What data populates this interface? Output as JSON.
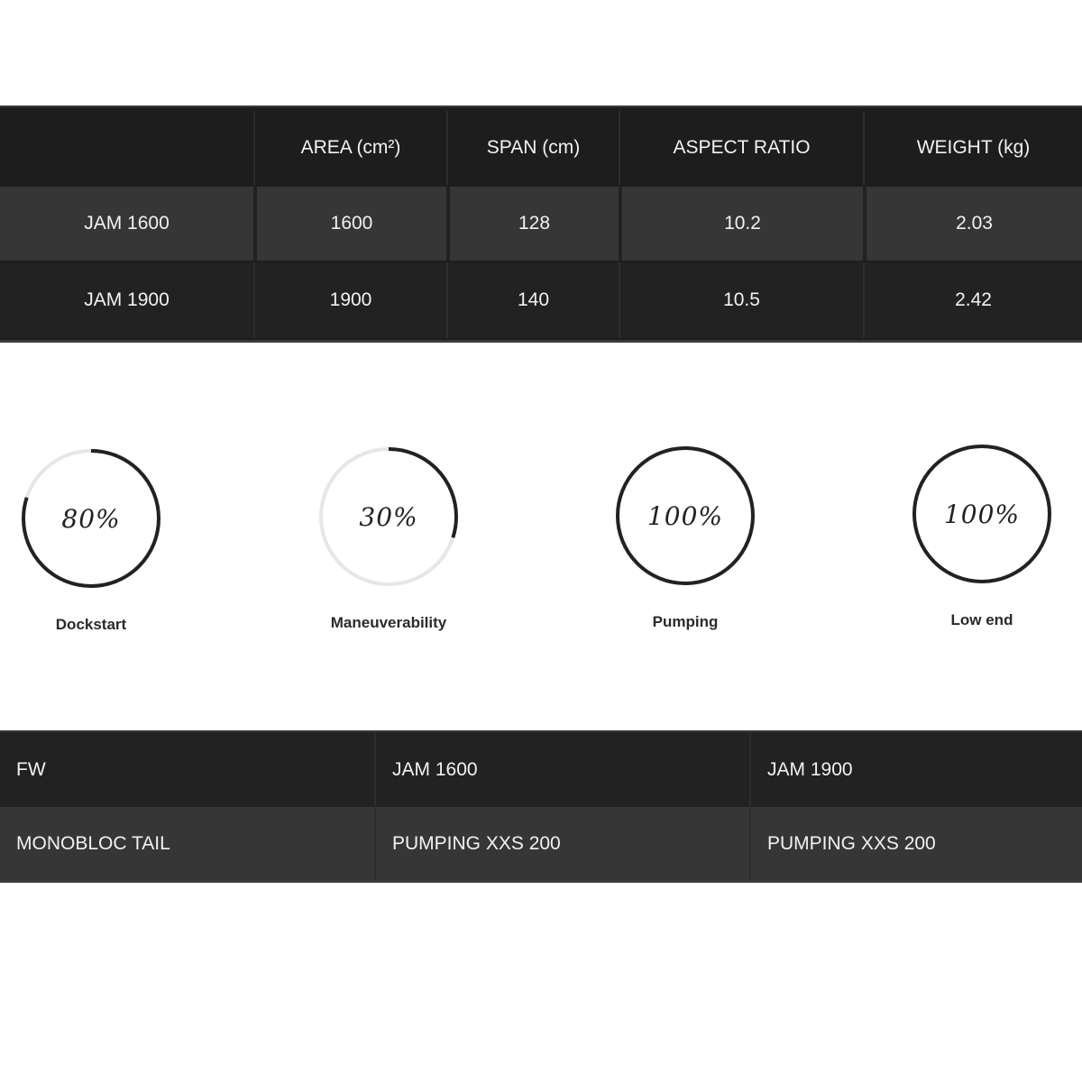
{
  "spec_table": {
    "headers": [
      "",
      "AREA (cm²)",
      "SPAN (cm)",
      "ASPECT RATIO",
      "WEIGHT (kg)"
    ],
    "rows": [
      [
        "JAM 1600",
        "1600",
        "128",
        "10.2",
        "2.03"
      ],
      [
        "JAM 1900",
        "1900",
        "140",
        "10.5",
        "2.42"
      ]
    ]
  },
  "gauges": [
    {
      "percent_text": "80%",
      "value": 80,
      "label": "Dockstart"
    },
    {
      "percent_text": "30%",
      "value": 30,
      "label": "Maneuverability"
    },
    {
      "percent_text": "100%",
      "value": 100,
      "label": "Pumping"
    },
    {
      "percent_text": "100%",
      "value": 100,
      "label": "Low end"
    }
  ],
  "combo_table": {
    "headers": [
      "FW",
      "JAM 1600",
      "JAM 1900"
    ],
    "rows": [
      [
        "MONOBLOC TAIL",
        "PUMPING XXS 200",
        "PUMPING XXS 200"
      ]
    ]
  },
  "colors": {
    "table_dark": "#1d1d1d",
    "table_mid": "#363636",
    "gauge_track": "#e6e6e6",
    "gauge_fill": "#222222"
  }
}
